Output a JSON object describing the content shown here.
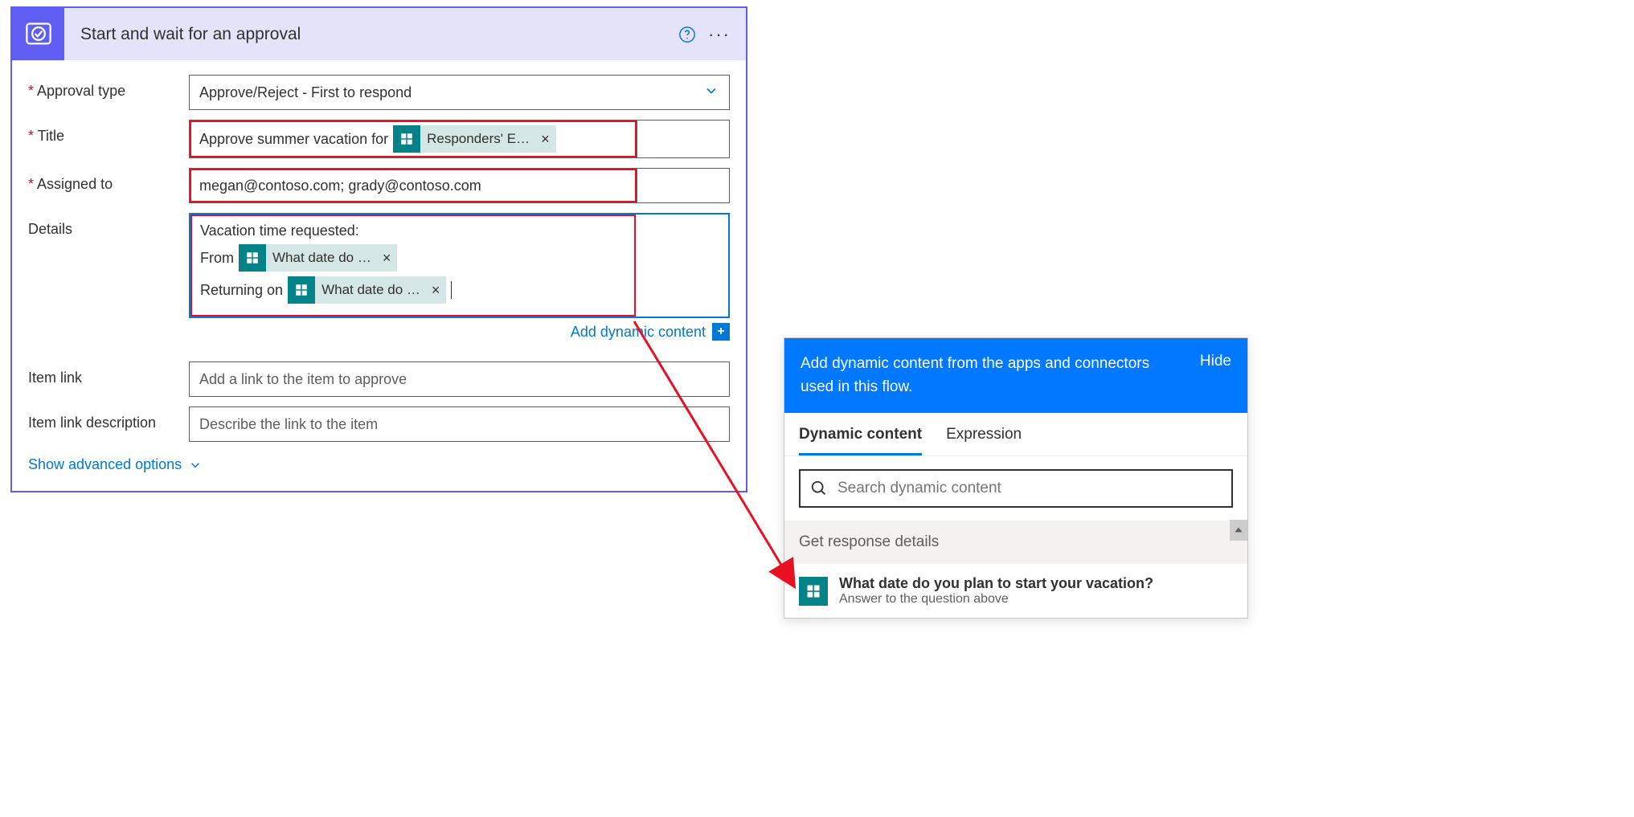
{
  "card": {
    "title": "Start and wait for an approval",
    "approval_type_label": "Approval type",
    "approval_type_value": "Approve/Reject - First to respond",
    "title_label": "Title",
    "title_prefix": "Approve summer vacation for ",
    "title_token": "Responders' E…",
    "assigned_to_label": "Assigned to",
    "assigned_to_value": "megan@contoso.com; grady@contoso.com",
    "details_label": "Details",
    "details_header": "Vacation time requested:",
    "details_from": "From",
    "details_from_token": "What date do …",
    "details_return": "Returning on",
    "details_return_token": "What date do …",
    "add_dynamic": "Add dynamic content",
    "item_link_label": "Item link",
    "item_link_placeholder": "Add a link to the item to approve",
    "item_link_desc_label": "Item link description",
    "item_link_desc_placeholder": "Describe the link to the item",
    "advanced": "Show advanced options"
  },
  "dc": {
    "header_text": "Add dynamic content from the apps and connectors used in this flow.",
    "hide": "Hide",
    "tab_dynamic": "Dynamic content",
    "tab_expression": "Expression",
    "search_placeholder": "Search dynamic content",
    "section": "Get response details",
    "item_title": "What date do you plan to start your vacation?",
    "item_sub": "Answer to the question above"
  }
}
